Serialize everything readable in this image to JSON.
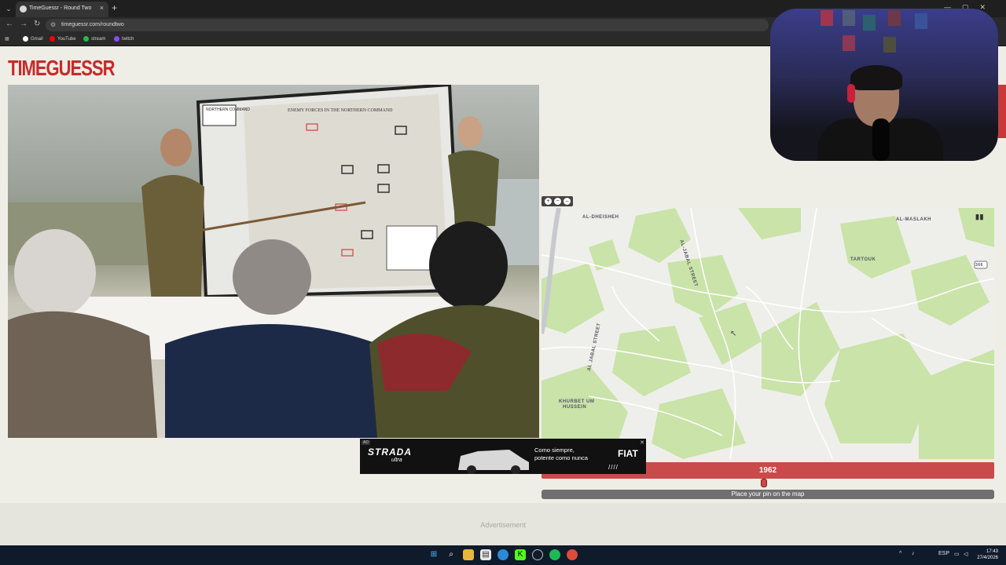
{
  "browser": {
    "tab_title": "TimeGuessr - Round Two",
    "tab_close": "×",
    "new_tab": "+",
    "url": "timeguessr.com/roundtwo",
    "bookmarks": [
      {
        "label": "Gmail",
        "color": "#ffffff"
      },
      {
        "label": "YouTube",
        "color": "#ff0000"
      },
      {
        "label": "stream",
        "color": "#1fbf4a"
      },
      {
        "label": "twitch",
        "color": "#9146ff"
      }
    ]
  },
  "game": {
    "logo": "TIMEGUESSR",
    "year": "1962",
    "pin_prompt": "Place your pin on the map",
    "map_labels": {
      "al_dheisheh": "AL-DHEISHEH",
      "al_maslakh": "AL-MASLAKH",
      "al_jabal_street": "AL-JABAL STREET",
      "tartouk": "TARTOUK",
      "al_jabal_street_2": "AL JABAL STREET",
      "khurbet": "KHURBET UM",
      "hussein": "HUSSEIN",
      "route": "366"
    },
    "photo_map_title": "NORTHERN COMMAND",
    "photo_map_heading": "ENEMY FORCES IN THE NORTHERN COMMAND"
  },
  "ads": {
    "banner_label": "AD",
    "banner_brand": "STRADA",
    "banner_sub": "ultra",
    "banner_tag1": "Como siempre,",
    "banner_tag2": "potente como nunca",
    "banner_fiat": "FIAT",
    "banner_stripes": "////",
    "footer": "Advertisement"
  },
  "taskbar": {
    "language": "ESP",
    "time": "17:43",
    "date": "27/4/2026"
  },
  "colors": {
    "brand_red": "#c82a2a",
    "year_bar": "#c94a4a",
    "page_bg": "#efeee6"
  }
}
